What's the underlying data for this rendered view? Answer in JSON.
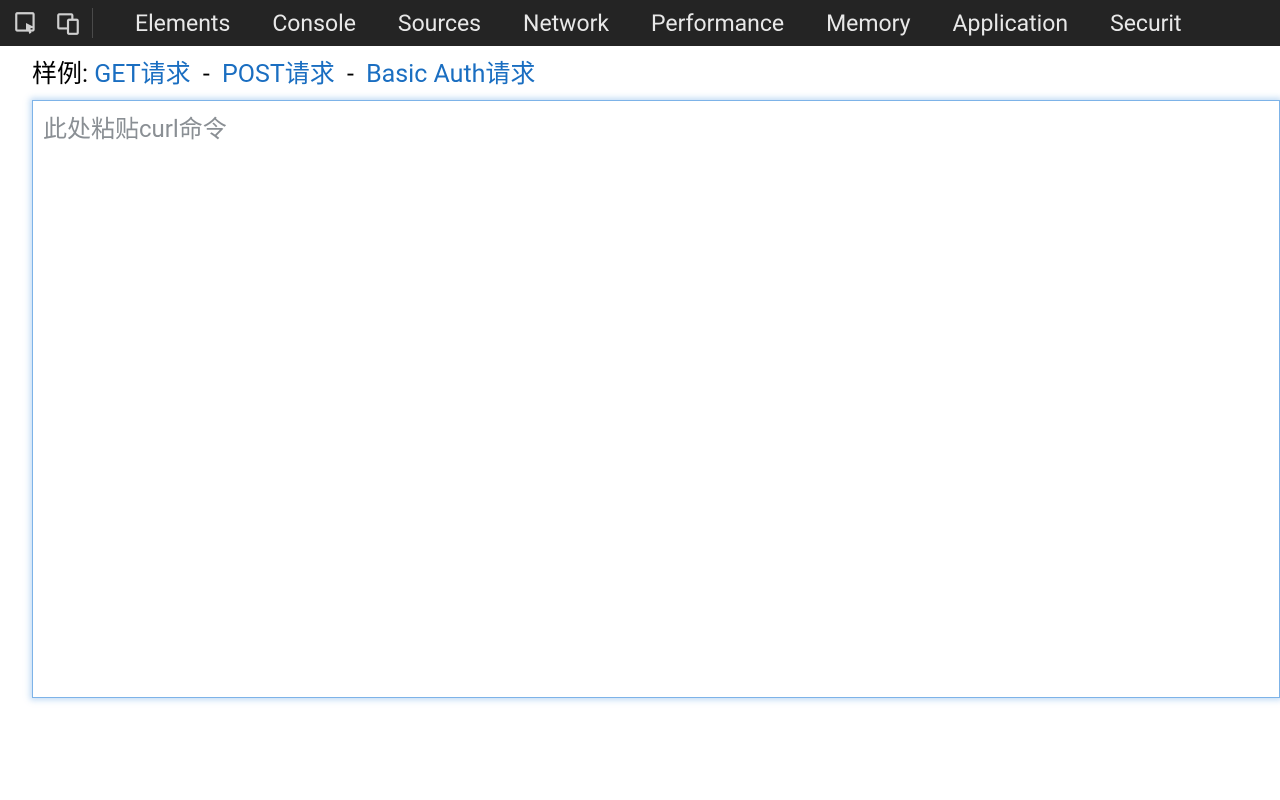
{
  "devtools": {
    "tabs": [
      "Elements",
      "Console",
      "Sources",
      "Network",
      "Performance",
      "Memory",
      "Application",
      "Securit"
    ]
  },
  "examples": {
    "label": "样例:",
    "links": {
      "get": "GET请求",
      "post": "POST请求",
      "basic_auth": "Basic Auth请求"
    },
    "separator": "-"
  },
  "input": {
    "placeholder": "此处粘贴curl命令",
    "value": ""
  }
}
